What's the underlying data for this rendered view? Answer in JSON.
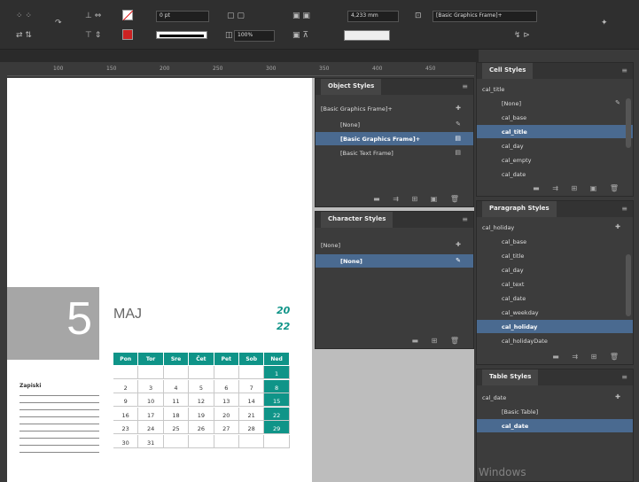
{
  "control_bar": {
    "stroke_weight": "0 pt",
    "zoom": "100%",
    "width_value": "4,233 mm",
    "object_style": "[Basic Graphics Frame]+"
  },
  "ruler": {
    "ticks": [
      "100",
      "150",
      "200",
      "250",
      "300",
      "350",
      "400",
      "450"
    ]
  },
  "object_styles": {
    "title": "Object Styles",
    "current": "[Basic Graphics Frame]+",
    "items": [
      "[None]",
      "[Basic Graphics Frame]+",
      "[Basic Text Frame]"
    ],
    "selected_index": 1
  },
  "character_styles": {
    "title": "Character Styles",
    "current": "[None]",
    "items": [
      "[None]"
    ],
    "selected_index": 0
  },
  "cell_styles": {
    "title": "Cell Styles",
    "current": "cal_title",
    "items": [
      "[None]",
      "cal_base",
      "cal_title",
      "cal_day",
      "cal_empty",
      "cal_date"
    ],
    "selected_index": 2
  },
  "paragraph_styles": {
    "title": "Paragraph Styles",
    "current": "cal_holiday",
    "items": [
      "cal_base",
      "cal_title",
      "cal_day",
      "cal_text",
      "cal_date",
      "cal_weekday",
      "cal_holiday",
      "cal_holidayDate"
    ],
    "selected_index": 6
  },
  "table_styles": {
    "title": "Table Styles",
    "current": "cal_date",
    "items": [
      "[Basic Table]",
      "cal_date"
    ],
    "selected_index": 1
  },
  "calendar": {
    "day_number": "5",
    "month": "MAJ",
    "year_top": "20",
    "year_bottom": "22",
    "notes_label": "Zapiski",
    "weekdays": [
      "Pon",
      "Tor",
      "Sre",
      "Čet",
      "Pet",
      "Sob",
      "Ned"
    ],
    "weeks": [
      [
        "",
        "",
        "",
        "",
        "",
        "",
        "1"
      ],
      [
        "2",
        "3",
        "4",
        "5",
        "6",
        "7",
        "8"
      ],
      [
        "9",
        "10",
        "11",
        "12",
        "13",
        "14",
        "15"
      ],
      [
        "16",
        "17",
        "18",
        "19",
        "20",
        "21",
        "22"
      ],
      [
        "23",
        "24",
        "25",
        "26",
        "27",
        "28",
        "29"
      ],
      [
        "30",
        "31",
        "",
        "",
        "",
        "",
        ""
      ]
    ]
  },
  "watermark": "Windows"
}
